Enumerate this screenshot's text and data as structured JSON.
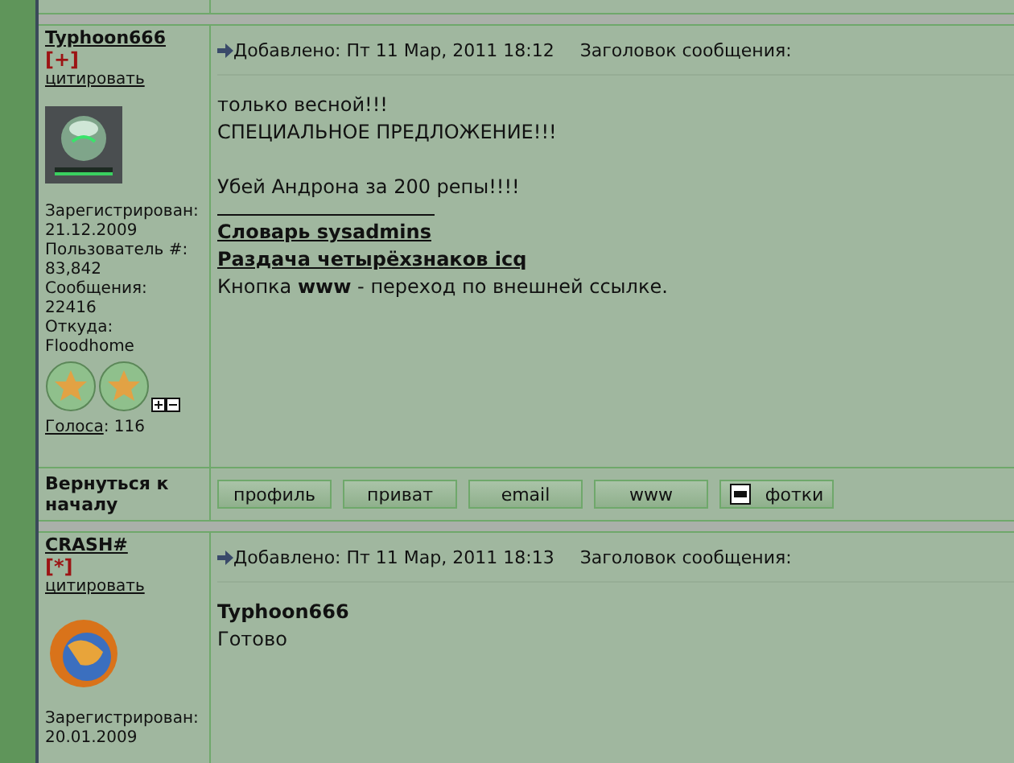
{
  "posts": [
    {
      "author": "Typhoon666",
      "rank_mark": "[+]",
      "quote_link": "цитировать",
      "avatar": {
        "kind": "sphere"
      },
      "profile": [
        "Зарегистрирован:",
        "21.12.2009",
        "Пользователь #:",
        "83,842",
        "Сообщения:",
        "22416",
        "Откуда:",
        "Floodhome"
      ],
      "rank_badges": true,
      "votes_link": "Голоса",
      "votes_value": ": 116",
      "posted": "Добавлено: Пт 11 Мар, 2011 18:12",
      "subject_label": "Заголовок сообщения:",
      "body": [
        {
          "kind": "text",
          "text": "только весной!!!"
        },
        {
          "kind": "text",
          "text": "СПЕЦИАЛЬНОЕ ПРЕДЛОЖЕНИЕ!!!"
        },
        {
          "kind": "blank"
        },
        {
          "kind": "text",
          "text": "Убей Андрона за 200 репы!!!!"
        },
        {
          "kind": "rule"
        },
        {
          "kind": "link",
          "text": "Словарь sysadmins"
        },
        {
          "kind": "link",
          "text": "Раздача четырёхзнаков icq"
        },
        {
          "kind": "text",
          "text": "Кнопка **www** - переход по внешней ссылке."
        }
      ],
      "footer": {
        "back_link": "Вернуться к началу",
        "buttons": [
          {
            "kind": "plain",
            "label": "профиль"
          },
          {
            "kind": "plain",
            "label": "приват"
          },
          {
            "kind": "plain",
            "label": "email"
          },
          {
            "kind": "plain",
            "label": "www"
          },
          {
            "kind": "photo",
            "label": "фотки"
          }
        ]
      }
    },
    {
      "author": "CRASH#",
      "rank_mark": "[*]",
      "quote_link": "цитировать",
      "avatar": {
        "kind": "globe"
      },
      "profile": [
        "Зарегистрирован:",
        "20.01.2009"
      ],
      "rank_badges": false,
      "posted": "Добавлено: Пт 11 Мар, 2011 18:13",
      "subject_label": "Заголовок сообщения:",
      "body": [
        {
          "kind": "bold",
          "text": "Typhoon666"
        },
        {
          "kind": "text",
          "text": "Готово"
        }
      ]
    }
  ]
}
